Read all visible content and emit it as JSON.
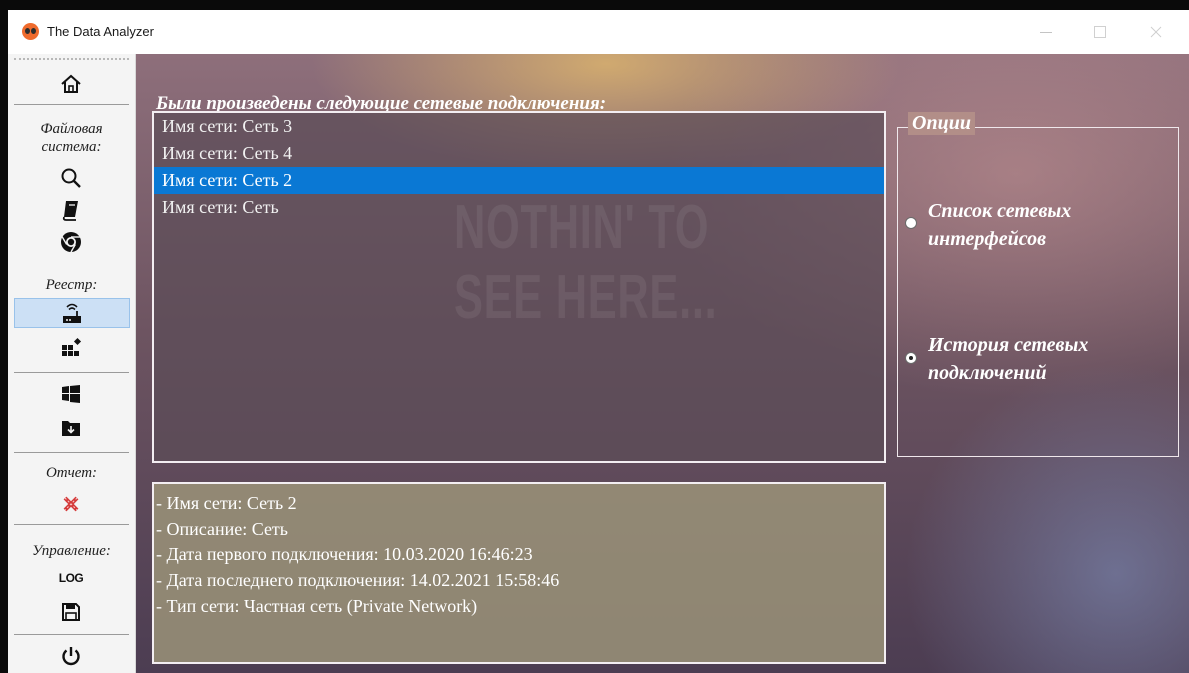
{
  "window": {
    "title": "The Data Analyzer"
  },
  "sidebar": {
    "home_icon": "home-icon",
    "sections": [
      {
        "label": "Файловая система:",
        "line1": "Файловая",
        "line2": "система:"
      },
      {
        "label": "Реестр:"
      },
      {
        "label": "Отчет:"
      },
      {
        "label": "Управление:"
      }
    ],
    "log_label": "LOG",
    "icons": [
      "search-icon",
      "book-icon",
      "chrome-icon",
      "router-icon",
      "apps-icon",
      "windows-icon",
      "folder-download-icon",
      "report-delete-icon",
      "log-icon",
      "save-icon",
      "power-icon"
    ]
  },
  "main": {
    "heading": "Были произведены следующие сетевые подключения:",
    "list_items": [
      {
        "label": "Имя сети: Сеть 3",
        "selected": false
      },
      {
        "label": "Имя сети: Сеть 4",
        "selected": false
      },
      {
        "label": "Имя сети: Сеть 2",
        "selected": true
      },
      {
        "label": "Имя сети: Сеть",
        "selected": false
      }
    ],
    "watermark_line1": "NOTHIN' TO",
    "watermark_line2": "SEE HERE...",
    "details": [
      "- Имя сети: Сеть 2",
      "- Описание: Сеть",
      "- Дата первого подключения: 10.03.2020   16:46:23",
      "- Дата последнего подключения: 14.02.2021   15:58:46",
      "- Тип сети: Частная сеть (Private Network)"
    ]
  },
  "options": {
    "legend": "Опции",
    "items": [
      {
        "line1": "Список сетевых",
        "line2": "интерфейсов",
        "checked": false
      },
      {
        "line1": "История сетевых",
        "line2": "подключений",
        "checked": true
      }
    ]
  },
  "colors": {
    "selection": "#0a78d4",
    "sidebar_bg": "#f4f4f4",
    "app_icon": "#ef6b2d"
  }
}
